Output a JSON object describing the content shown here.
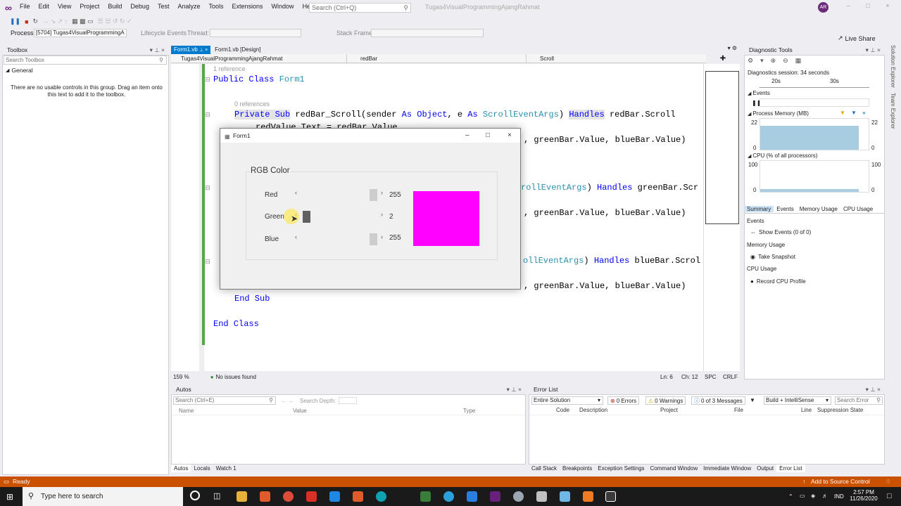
{
  "menu": {
    "items": [
      "File",
      "Edit",
      "View",
      "Project",
      "Build",
      "Debug",
      "Test",
      "Analyze",
      "Tools",
      "Extensions",
      "Window",
      "Help"
    ],
    "search_placeholder": "Search (Ctrl+Q)",
    "solution_name": "Tugas4VisualProgrammingAjangRahmat",
    "avatar_initials": "AR",
    "live_share": "Live Share"
  },
  "debugbar": {
    "process_label": "Process:",
    "process_value": "[5704] Tugas4VisualProgrammingA",
    "lifecycle": "Lifecycle Events",
    "thread_label": "Thread:",
    "stackframe_label": "Stack Frame:"
  },
  "toolbox": {
    "title": "Toolbox",
    "search_placeholder": "Search Toolbox",
    "group": "General",
    "message": "There are no usable controls in this group. Drag an item onto this text to add it to the toolbox."
  },
  "editor": {
    "tabs": [
      "Form1.vb",
      "Form1.vb [Design]"
    ],
    "nav_project": "Tugas4VisualProgrammingAjangRahmat",
    "nav_object": "redBar",
    "nav_event": "Scroll",
    "ref1": "1 reference",
    "ref0": "0 references",
    "zoom": "159 %",
    "issues": "No issues found",
    "ln": "Ln: 6",
    "ch": "Ch: 12",
    "spc": "SPC",
    "crlf": "CRLF",
    "code": {
      "l1_kw": "Public Class",
      "l1_cls": "Form1",
      "l2_kw1": "Private Sub",
      "l2_name": "redBar_Scroll(sender",
      "l2_kw2": "As Object",
      "l2_e": ", e",
      "l2_as": "As",
      "l2_type": "ScrollEventArgs",
      "l2_rest": ")",
      "l2_handles": "Handles",
      "l2_target": "redBar.Scroll",
      "l3": "redValue.Text = redBar.Value",
      "l4": ", greenBar.Value, blueBar.Value)",
      "l5_type": "rollEventArgs",
      "l5_rest": ")",
      "l5_handles": "Handles",
      "l5_target": "greenBar.Scr",
      "l6": ", greenBar.Value, blueBar.Value)",
      "l7_type": "ollEventArgs",
      "l7_rest": ")",
      "l7_handles": "Handles",
      "l7_target": "blueBar.Scrol",
      "l8": ", greenBar.Value, blueBar.Value)",
      "l9": "End Sub",
      "l10": "End Class"
    }
  },
  "form1": {
    "title": "Form1",
    "group_label": "RGB Color",
    "red_label": "Red",
    "green_label": "Green",
    "blue_label": "Blue",
    "red_value": "255",
    "green_value": "2",
    "blue_value": "255",
    "red_level": 1.0,
    "green_level": 0.008,
    "blue_level": 1.0,
    "swatch_color": "#ff02ff"
  },
  "diag": {
    "title": "Diagnostic Tools",
    "session": "Diagnostics session: 34 seconds",
    "t20": "20s",
    "t30": "30s",
    "events": "Events",
    "process_memory": "Process Memory (MB)",
    "mem_max": "22",
    "mem_min": "0",
    "cpu": "CPU (% of all processors)",
    "cpu_max": "100",
    "cpu_min": "0",
    "tabs": [
      "Summary",
      "Events",
      "Memory Usage",
      "CPU Usage"
    ],
    "sec_events": "Events",
    "show_events": "Show Events (0 of 0)",
    "sec_memory": "Memory Usage",
    "take_snapshot": "Take Snapshot",
    "sec_cpu": "CPU Usage",
    "record_cpu": "Record CPU Profile",
    "side_tabs": [
      "Solution Explorer",
      "Team Explorer"
    ]
  },
  "autos": {
    "title": "Autos",
    "search_placeholder": "Search (Ctrl+E)",
    "search_depth": "Search Depth:",
    "cols": [
      "Name",
      "Value",
      "Type"
    ],
    "tabs": [
      "Autos",
      "Locals",
      "Watch 1"
    ]
  },
  "errors": {
    "title": "Error List",
    "scope": "Entire Solution",
    "errors": "0 Errors",
    "warnings": "0 Warnings",
    "messages": "0 of 3 Messages",
    "build": "Build + IntelliSense",
    "search_placeholder": "Search Error",
    "cols": [
      "Code",
      "Description",
      "Project",
      "File",
      "Line",
      "Suppression State"
    ],
    "tabs": [
      "Call Stack",
      "Breakpoints",
      "Exception Settings",
      "Command Window",
      "Immediate Window",
      "Output",
      "Error List"
    ]
  },
  "status": {
    "ready": "Ready",
    "source_control": "Add to Source Control"
  },
  "taskbar": {
    "search": "Type here to search",
    "lang": "IND",
    "time": "2:57 PM",
    "date": "11/26/2020"
  }
}
